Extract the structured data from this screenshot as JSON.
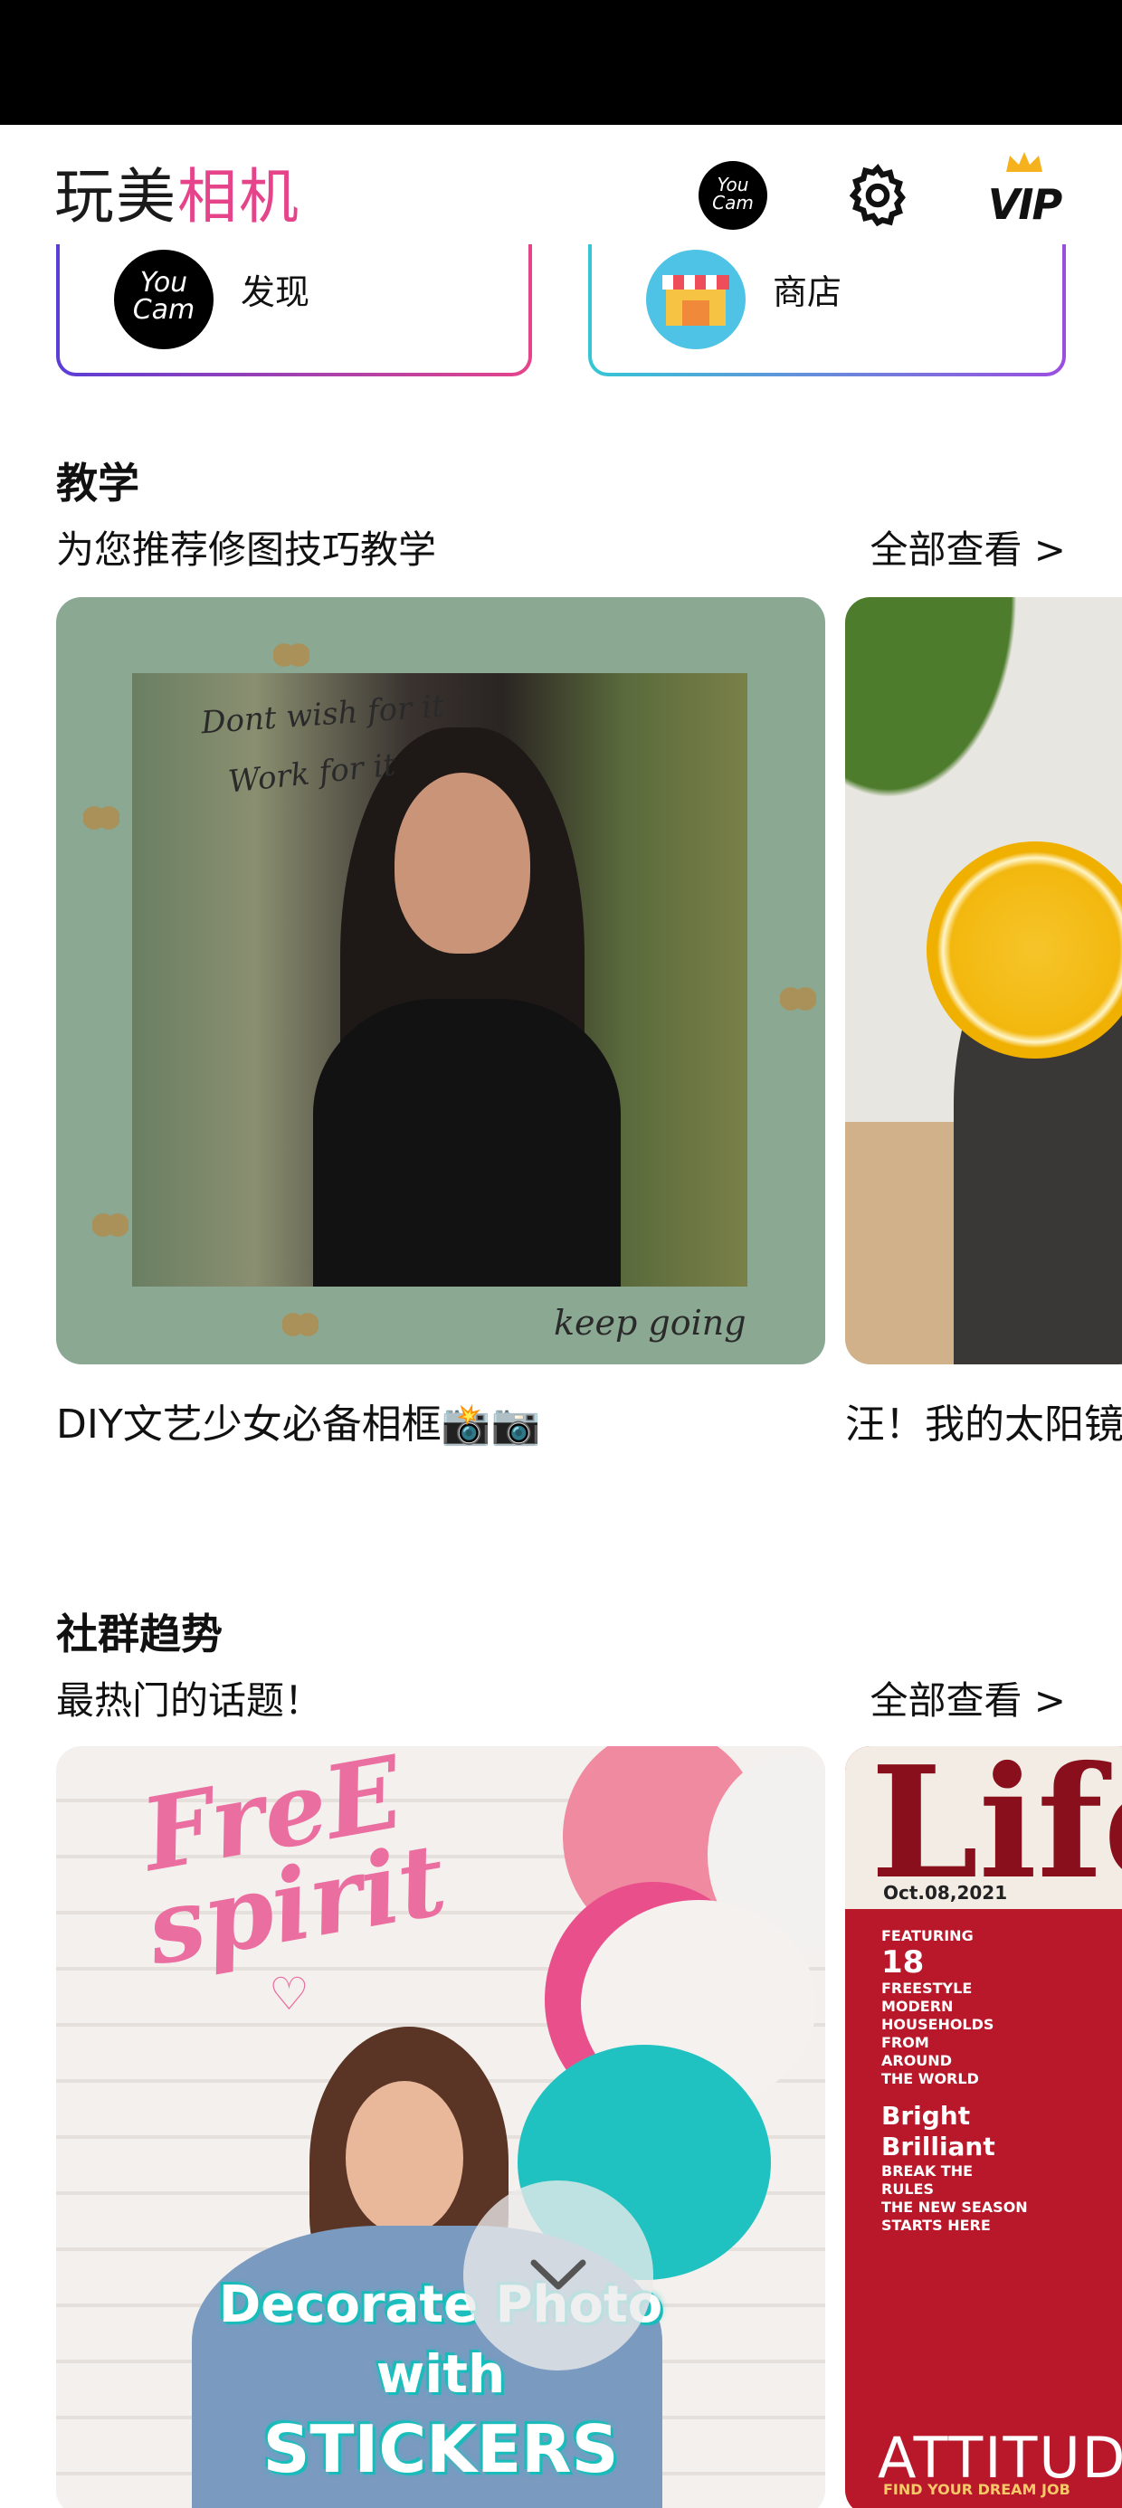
{
  "app": {
    "title_part1": "玩美",
    "title_part2": "相机",
    "youcam_badge": "You Cam",
    "vip_label": "VIP"
  },
  "quick_actions": [
    {
      "label": "发现",
      "icon": "youcam-logo-icon",
      "icon_text": "You Cam"
    },
    {
      "label": "商店",
      "icon": "store-icon"
    }
  ],
  "tutorials": {
    "title": "教学",
    "subtitle": "为您推荐修图技巧教学",
    "view_all": "全部查看 >",
    "items": [
      {
        "caption": "DIY文艺少女必备相框📸📷",
        "image_text": [
          "Dont wish for it",
          "Work for it",
          "keep going"
        ]
      },
      {
        "caption": "汪！我的太阳镜"
      }
    ]
  },
  "community": {
    "title": "社群趋势",
    "subtitle": "最热门的话题！",
    "view_all": "全部查看 >",
    "items": [
      {
        "image_text": [
          "FreE",
          "spirit",
          "Decorate Photo",
          "with",
          "STICKERS"
        ]
      },
      {
        "image_text": [
          "Life",
          "Oct.08,2021",
          "FEATURING",
          "18",
          "FREESTYLE",
          "MODERN",
          "HOUSEHOLDS",
          "FROM",
          "AROUND",
          "THE WORLD",
          "Bright",
          "Brilliant",
          "BREAK THE",
          "RULES",
          "THE NEW SEASON",
          "STARTS HERE",
          "ATTITUDE",
          "FIND YOUR DREAM JOB"
        ]
      }
    ]
  },
  "colors": {
    "accent_pink": "#e6448a",
    "status_bar": "#000000"
  }
}
